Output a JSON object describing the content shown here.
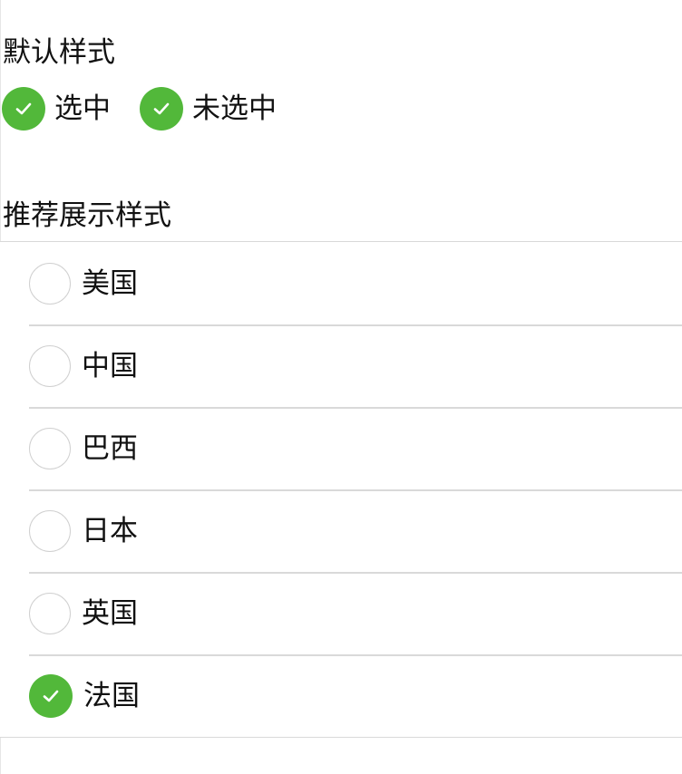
{
  "default_section": {
    "title": "默认样式",
    "options": [
      {
        "label": "选中",
        "checked": true
      },
      {
        "label": "未选中",
        "checked": true
      }
    ]
  },
  "recommended_section": {
    "title": "推荐展示样式",
    "items": [
      {
        "label": "美国",
        "checked": false
      },
      {
        "label": "中国",
        "checked": false
      },
      {
        "label": "巴西",
        "checked": false
      },
      {
        "label": "日本",
        "checked": false
      },
      {
        "label": "英国",
        "checked": false
      },
      {
        "label": "法国",
        "checked": true
      }
    ]
  },
  "colors": {
    "checked_fill": "#52b83a",
    "unchecked_border": "#d0d0d0",
    "divider": "#d9d9d9"
  },
  "icons": {
    "checked": "checkmark-circle-icon",
    "unchecked": "empty-circle-icon"
  }
}
